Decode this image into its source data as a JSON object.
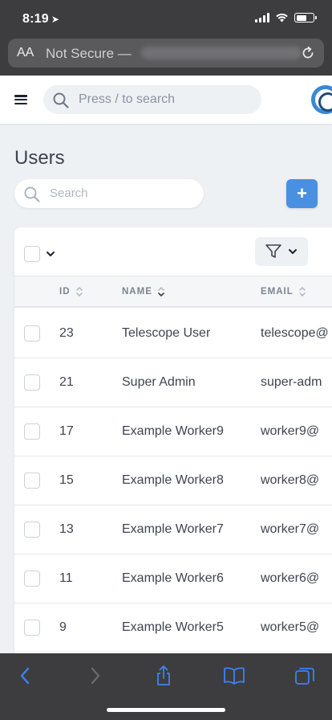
{
  "status_bar": {
    "time": "8:19",
    "location_arrow": "➤"
  },
  "url_bar": {
    "aa_label": "AA",
    "security_text": "Not Secure —"
  },
  "header": {
    "search_placeholder": "Press / to search"
  },
  "page": {
    "title": "Users",
    "search_placeholder": "Search",
    "create_label": "+"
  },
  "table": {
    "columns": [
      {
        "key": "id",
        "label": "ID"
      },
      {
        "key": "name",
        "label": "NAME"
      },
      {
        "key": "email",
        "label": "EMAIL"
      }
    ],
    "rows": [
      {
        "id": "23",
        "name": "Telescope User",
        "email": "telescope@"
      },
      {
        "id": "21",
        "name": "Super Admin",
        "email": "super-adm"
      },
      {
        "id": "17",
        "name": "Example Worker9",
        "email": "worker9@"
      },
      {
        "id": "15",
        "name": "Example Worker8",
        "email": "worker8@"
      },
      {
        "id": "13",
        "name": "Example Worker7",
        "email": "worker7@"
      },
      {
        "id": "11",
        "name": "Example Worker6",
        "email": "worker6@"
      },
      {
        "id": "9",
        "name": "Example Worker5",
        "email": "worker5@"
      }
    ]
  },
  "icons": {
    "back": "chevron-left-icon",
    "forward": "chevron-right-icon",
    "share": "share-icon",
    "bookmarks": "book-icon",
    "tabs": "tabs-icon",
    "filter": "filter-icon",
    "search": "search-icon",
    "reload": "reload-icon"
  },
  "colors": {
    "accent": "#4a90e2",
    "safari_chrome": "#3d3d3f",
    "ios_blue": "#3b82f6",
    "page_bg": "#eef1f4"
  }
}
